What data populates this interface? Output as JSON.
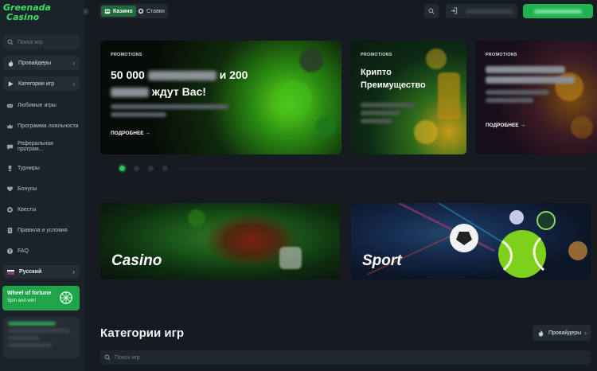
{
  "brand": {
    "logo_line1": "Greenada",
    "logo_line2": "Casino",
    "accent": "#22b150"
  },
  "topbar": {
    "tabs": [
      {
        "label": "Казино",
        "icon": "casino-icon",
        "active": true
      },
      {
        "label": "Ставки",
        "icon": "sports-icon",
        "active": false
      }
    ]
  },
  "sidebar": {
    "search_placeholder": "Поиск игр",
    "providers_label": "Провайдеры",
    "categories_label": "Категории игр",
    "items": [
      {
        "label": "Любимые игры",
        "icon": "favorites-icon"
      },
      {
        "label": "Программа лояльности",
        "icon": "crown-icon"
      },
      {
        "label": "Реферальная програм...",
        "icon": "chat-icon"
      },
      {
        "label": "Турниры",
        "icon": "trophy-icon"
      },
      {
        "label": "Бонусы",
        "icon": "heart-icon"
      },
      {
        "label": "Квесты",
        "icon": "quest-icon"
      },
      {
        "label": "Правила и условия",
        "icon": "document-icon"
      },
      {
        "label": "FAQ",
        "icon": "question-icon"
      }
    ],
    "language": "Русский",
    "wheel": {
      "title": "Wheel of fortune",
      "subtitle": "Spin and win!"
    }
  },
  "banners": [
    {
      "tag": "PROMOTIONS",
      "title_part1": "50 000",
      "title_part2": "и 200",
      "title_part3": "ждут Вас!",
      "more": "ПОДРОБНЕЕ"
    },
    {
      "tag": "PROMOTIONS",
      "title_line1": "Крипто",
      "title_line2": "Преимущество",
      "more": ""
    },
    {
      "tag": "PROMOTIONS",
      "more": "ПОДРОБНЕЕ"
    }
  ],
  "carousel": {
    "pages": 4,
    "active": 1
  },
  "tiles": {
    "casino": "Casino",
    "sport": "Sport"
  },
  "categories": {
    "title": "Категории игр",
    "providers_button": "Провайдеры",
    "search_placeholder": "Поиск игр"
  }
}
